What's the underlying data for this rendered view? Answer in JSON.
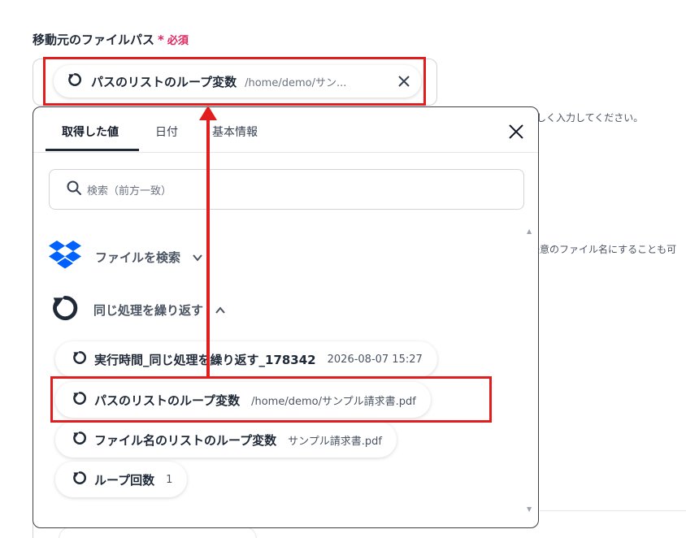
{
  "field": {
    "label": "移動元のファイルパス",
    "required_star": "*",
    "required_text": "必須"
  },
  "selected_chip": {
    "name": "パスのリストのループ変数",
    "value": "/home/demo/サン..."
  },
  "background_hints": {
    "hint1": "しく入力してください。",
    "hint2": "任意のファイル名にすることも可"
  },
  "popup": {
    "tabs": [
      {
        "label": "取得した値",
        "active": true
      },
      {
        "label": "日付",
        "active": false
      },
      {
        "label": "基本情報",
        "active": false
      }
    ],
    "search_placeholder": "検索（前方一致）",
    "groups": [
      {
        "label": "ファイルを検索",
        "icon": "dropbox-icon",
        "expanded": false
      },
      {
        "label": "同じ処理を繰り返す",
        "icon": "loop-icon",
        "expanded": true
      }
    ],
    "items": [
      {
        "name": "実行時間_同じ処理を繰り返す_178342",
        "value": "2026-08-07 15:27"
      },
      {
        "name": "パスのリストのループ変数",
        "value": "/home/demo/サンプル請求書.pdf"
      },
      {
        "name": "ファイル名のリストのループ変数",
        "value": "サンプル請求書.pdf"
      },
      {
        "name": "ループ回数",
        "value": "1"
      }
    ]
  },
  "colors": {
    "highlight": "#e11d1d",
    "required": "#e0245e",
    "dropbox": "#0061fe"
  }
}
